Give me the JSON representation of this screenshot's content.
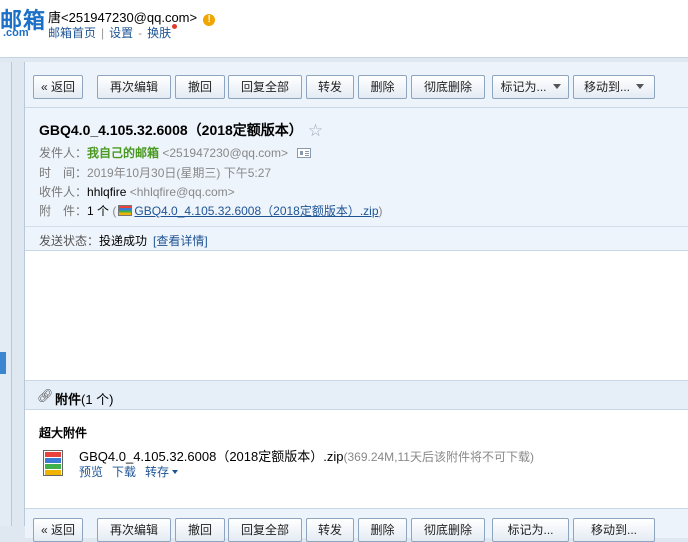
{
  "header": {
    "logo_text": "邮箱",
    "logo_sub": ".com",
    "user_name": "唐",
    "user_email": "<251947230@qq.com>",
    "links": [
      "邮箱首页",
      "设置",
      "换肤"
    ]
  },
  "toolbar": {
    "back": "« 返回",
    "reedit": "再次编辑",
    "recall": "撤回",
    "reply_all": "回复全部",
    "forward": "转发",
    "delete": "删除",
    "delete_forever": "彻底删除",
    "mark_as": "标记为...",
    "move_to": "移动到..."
  },
  "mail": {
    "subject": "GBQ4.0_4.105.32.6008（2018定额版本）",
    "from_label": "发件人：",
    "from_name": "我自己的邮箱",
    "from_email": "<251947230@qq.com>",
    "time_label": "时　间：",
    "time_value": "2019年10月30日(星期三) 下午5:27",
    "to_label": "收件人：",
    "to_name": "hhlqfire",
    "to_email": "<hhlqfire@qq.com>",
    "attach_label": "附　件：",
    "attach_count": "1 个",
    "attach_open": "(",
    "attach_file": "GBQ4.0_4.105.32.6008（2018定额版本）.zip",
    "attach_close": ")",
    "status_label": "发送状态：",
    "status_value": "投递成功",
    "status_link": "[查看详情]"
  },
  "attachments": {
    "title": "附件",
    "count": "(1 个)",
    "big_label": "超大附件",
    "file_name": "GBQ4.0_4.105.32.6008（2018定额版本）.zip",
    "file_meta": "(369.24M,11天后该附件将不可下载)",
    "actions": [
      "预览",
      "下载",
      "转存"
    ]
  },
  "colors": {
    "accent": "#1e5494",
    "sender": "#4a9a22",
    "header_bg": "#eef4fb"
  }
}
